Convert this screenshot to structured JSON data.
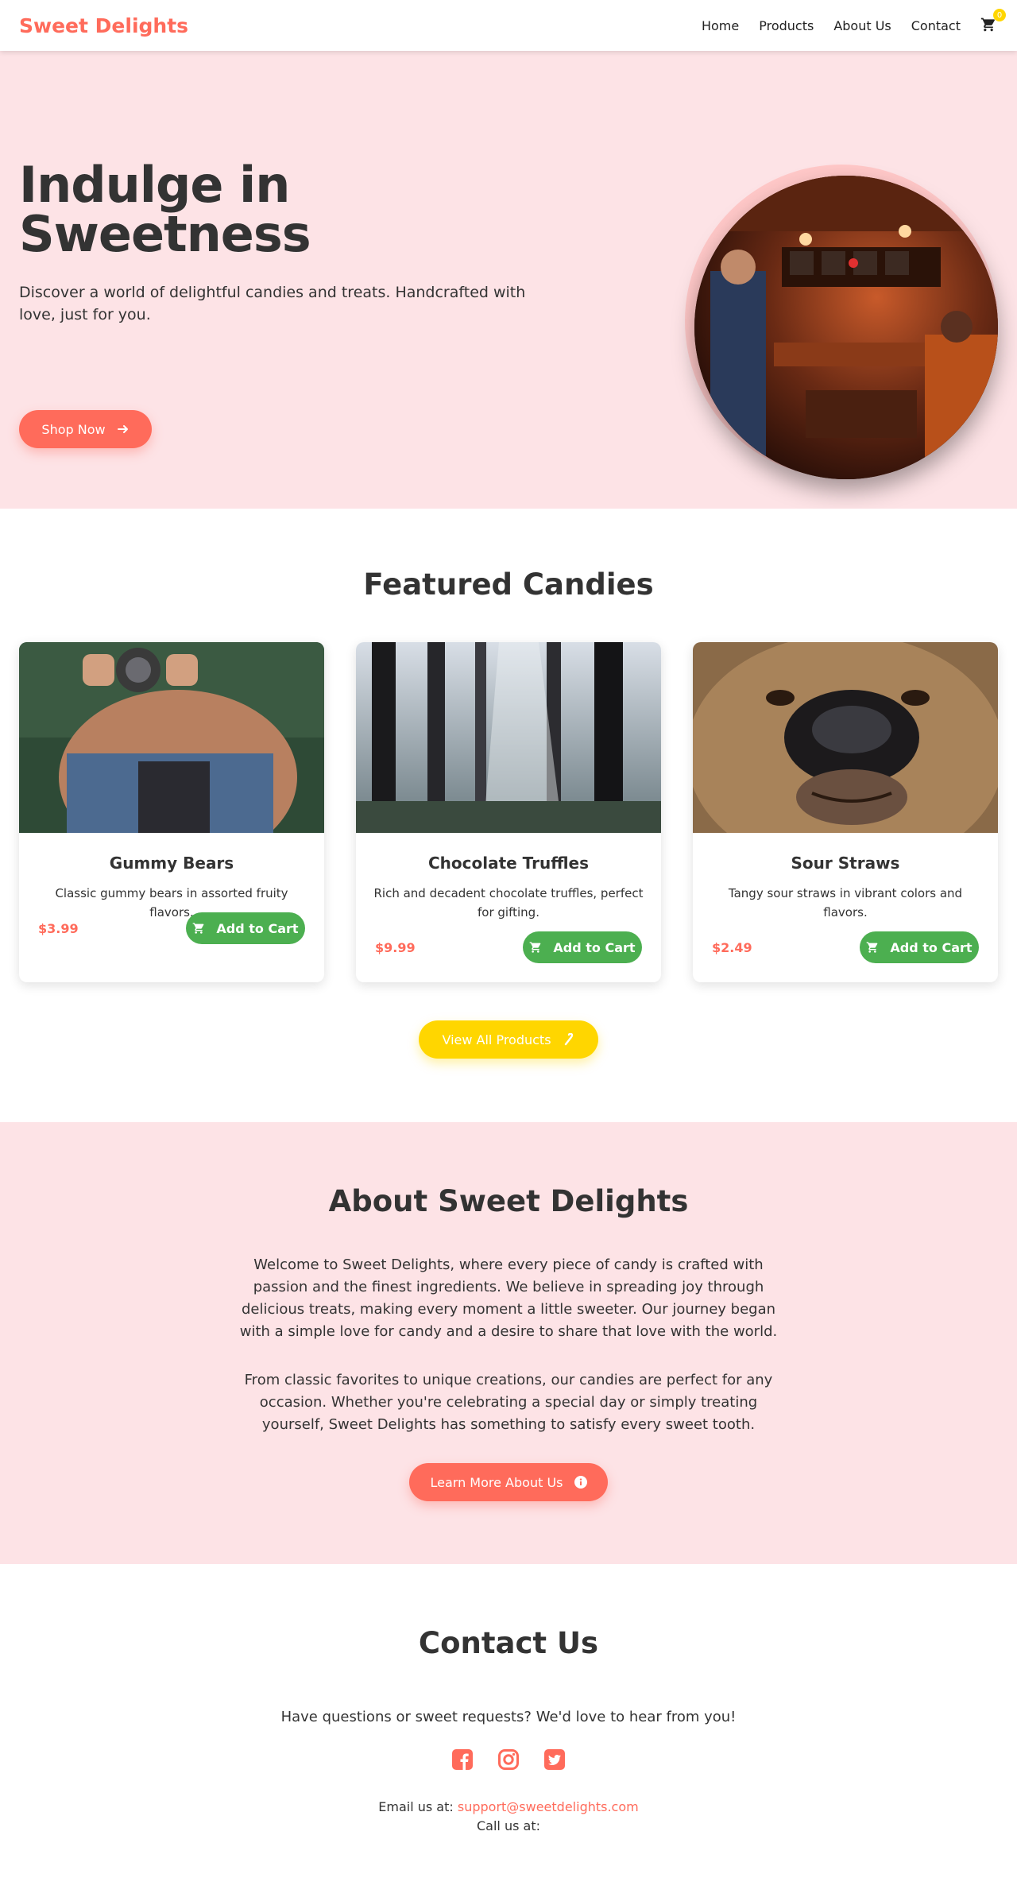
{
  "nav": {
    "brand": "Sweet Delights",
    "links": [
      "Home",
      "Products",
      "About Us",
      "Contact"
    ],
    "cart_count": "0"
  },
  "hero": {
    "title": "Indulge in Sweetness",
    "subtitle": "Discover a world of delightful candies and treats. Handcrafted with love, just for you.",
    "cta": "Shop Now",
    "image": "bar-interior-photo"
  },
  "featured": {
    "title": "Featured Candies",
    "products": [
      {
        "name": "Gummy Bears",
        "description": "Classic gummy bears in assorted fruity flavors.",
        "price": "$3.99",
        "button": "Add to Cart",
        "image": "woman-with-camera-photo"
      },
      {
        "name": "Chocolate Truffles",
        "description": "Rich and decadent chocolate truffles, perfect for gifting.",
        "price": "$9.99",
        "button": "Add to Cart",
        "image": "forest-trees-photo"
      },
      {
        "name": "Sour Straws",
        "description": "Tangy sour straws in vibrant colors and flavors.",
        "price": "$2.49",
        "button": "Add to Cart",
        "image": "bear-face-photo"
      }
    ],
    "view_all": "View All Products"
  },
  "about": {
    "title": "About Sweet Delights",
    "paragraph1": "Welcome to Sweet Delights, where every piece of candy is crafted with passion and the finest ingredients. We believe in spreading joy through delicious treats, making every moment a little sweeter. Our journey began with a simple love for candy and a desire to share that love with the world.",
    "paragraph2": "From classic favorites to unique creations, our candies are perfect for any occasion. Whether you're celebrating a special day or simply treating yourself, Sweet Delights has something to satisfy every sweet tooth.",
    "cta": "Learn More About Us"
  },
  "contact": {
    "title": "Contact Us",
    "lead": "Have questions or sweet requests? We'd love to hear from you!",
    "socials": [
      "facebook-icon",
      "instagram-icon",
      "twitter-icon"
    ],
    "email_label": "Email us at:",
    "email": "support@sweetdelights.com",
    "phone_label": "Call us at:"
  },
  "colors": {
    "brand": "#ff6b5b",
    "hero_bg": "#fde3e6",
    "green": "#4caf50",
    "yellow": "#ffd600"
  }
}
